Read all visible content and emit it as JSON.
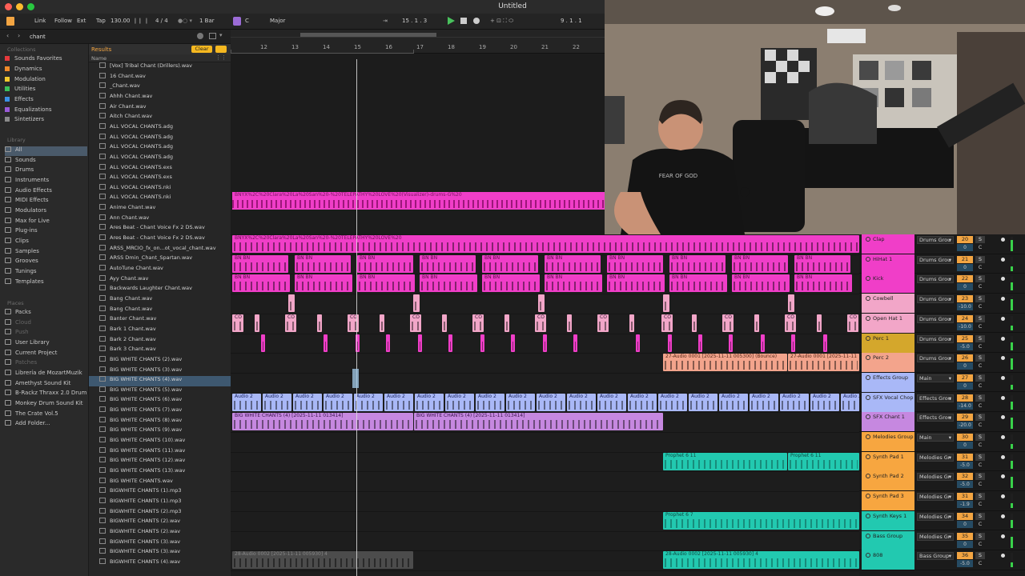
{
  "window": {
    "title": "Untitled"
  },
  "control_bar": {
    "link": "Link",
    "follow": "Follow",
    "ext": "Ext",
    "tap": "Tap",
    "tempo": "130.00",
    "signature": "4 / 4",
    "quantize": "1 Bar",
    "key": "C",
    "scale": "Major",
    "position": "15 .  1 .  3",
    "loop_end": "9 .  1 .  1"
  },
  "browser": {
    "search_value": "chant",
    "collections_label": "Collections",
    "collections": [
      {
        "label": "Sounds Favorites",
        "color": "#e5393c"
      },
      {
        "label": "Dynamics",
        "color": "#f08a2a"
      },
      {
        "label": "Modulation",
        "color": "#f2c82e"
      },
      {
        "label": "Utilities",
        "color": "#3ac05a"
      },
      {
        "label": "Effects",
        "color": "#3a90e5"
      },
      {
        "label": "Equalizations",
        "color": "#9a5ad8"
      },
      {
        "label": "Sintetizers",
        "color": "#8a8a8a"
      }
    ],
    "library_label": "Library",
    "library": [
      "All",
      "Sounds",
      "Drums",
      "Instruments",
      "Audio Effects",
      "MIDI Effects",
      "Modulators",
      "Max for Live",
      "Plug-ins",
      "Clips",
      "Samples",
      "Grooves",
      "Tunings",
      "Templates"
    ],
    "places_label": "Places",
    "places": [
      "Packs",
      "Cloud",
      "Push",
      "User Library",
      "Current Project",
      "Patches",
      "Librería de MozartMuzik",
      "Amethyst Sound Kit",
      "B-Rackz Thraxx 2.0 Drum",
      "Monkey Drum Sound Kit",
      "The Crate Vol.5",
      "Add Folder..."
    ],
    "results_label": "Results",
    "clear_label": "Clear",
    "name_header": "Name",
    "files": [
      "[Vox] Tribal Chant (Drillers).wav",
      "16 Chant.wav",
      "_Chant.wav",
      "Ahhh Chant.wav",
      "Air Chant.wav",
      "Aitch Chant.wav",
      "ALL VOCAL CHANTS.adg",
      "ALL VOCAL CHANTS.adg",
      "ALL VOCAL CHANTS.adg",
      "ALL VOCAL CHANTS.adg",
      "ALL VOCAL CHANTS.exs",
      "ALL VOCAL CHANTS.exs",
      "ALL VOCAL CHANTS.nki",
      "ALL VOCAL CHANTS.nki",
      "Anime Chant.wav",
      "Ann Chant.wav",
      "Ares Beat - Chant Voice Fx 2 DS.wav",
      "Ares Beat - Chant Voice Fx 2 DS.wav",
      "ARSS_MRCIO_fx_on...ot_vocal_chant.wav",
      "ARSS Dmin_Chant_Spartan.wav",
      "AutoTune Chant.wav",
      "Ayy Chant.wav",
      "Backwards Laughter Chant.wav",
      "Bang Chant.wav",
      "Bang Chant.wav",
      "Banter Chant.wav",
      "Bark 1 Chant.wav",
      "Bark 2 Chant.wav",
      "Bark 3 Chant.wav",
      "BIG WHITE CHANTS (2).wav",
      "BIG WHITE CHANTS (3).wav",
      "BIG WHITE CHANTS (4).wav",
      "BIG WHITE CHANTS (5).wav",
      "BIG WHITE CHANTS (6).wav",
      "BIG WHITE CHANTS (7).wav",
      "BIG WHITE CHANTS (8).wav",
      "BIG WHITE CHANTS (9).wav",
      "BIG WHITE CHANTS (10).wav",
      "BIG WHITE CHANTS (11).wav",
      "BIG WHITE CHANTS (12).wav",
      "BIG WHITE CHANTS (13).wav",
      "BIG WHITE CHANTS.wav",
      "BIGWHITE CHANTS (1).mp3",
      "BIGWHITE CHANTS (1).mp3",
      "BIGWHITE CHANTS (2).mp3",
      "BIGWHITE CHANTS (2).wav",
      "BIGWHITE CHANTS (2).wav",
      "BIGWHITE CHANTS (3).wav",
      "BIGWHITE CHANTS (3).wav",
      "BIGWHITE CHANTS (4).wav"
    ],
    "selected_file": "BIG WHITE CHANTS (4).wav"
  },
  "ruler": {
    "bars": [
      "12",
      "13",
      "14",
      "15",
      "16",
      "17",
      "18",
      "19",
      "20",
      "21",
      "22"
    ]
  },
  "clips": {
    "top_drum": "BNYX%2C%20Clara%20La%20San%20-%20TELEPATHY%20LOVE%20(Visualizer)-drums-G%20",
    "drum_row": "BNYX%2C%20Clara%20La%20San%20-%20TELEPATHY%20LOVE%20",
    "short_bn": "BN BN",
    "cowbell_short": "CO",
    "bounce1": "27-Audio 0001 [2025-11-11 005300] (Bounce)",
    "bounce2": "27-Audio 0001 [2025-11-11",
    "audio2": "Audio 2",
    "big_white1": "BIG WHITE CHANTS (4) [2025-11-11 013414]",
    "big_white2": "BIG WHITE CHANTS (4) [2025-11-11 013414]",
    "prophet1": "Prophet 6 11",
    "prophet2": "Prophet 6 11",
    "prophet3": "Prophet 6 7",
    "audio0002a": "28-Audio 0002 [2025-11-11 005930] 4",
    "audio0002b": "28-Audio 0002 [2025-11-11 005930] 4"
  },
  "tracks": [
    {
      "name": "Clap",
      "color": "#f03ec8",
      "io": "Drums Grou",
      "num": "20",
      "vol": "0"
    },
    {
      "name": "HiHat 1",
      "color": "#f03ec8",
      "io": "Drums Grou",
      "num": "21",
      "vol": "0"
    },
    {
      "name": "Kick",
      "color": "#f03ec8",
      "io": "Drums Grou",
      "num": "22",
      "vol": "0"
    },
    {
      "name": "Cowbell",
      "color": "#f2a6c8",
      "io": "Drums Grou",
      "num": "23",
      "vol": "-10.0"
    },
    {
      "name": "Open Hat 1",
      "color": "#f2a6c8",
      "io": "Drums Grou",
      "num": "24",
      "vol": "-10.0"
    },
    {
      "name": "Perc 1",
      "color": "#d4a72c",
      "io": "Drums Grou",
      "num": "25",
      "vol": "-5.0"
    },
    {
      "name": "Perc 2",
      "color": "#f3a48c",
      "io": "Drums Grou",
      "num": "26",
      "vol": "0"
    },
    {
      "name": "Effects Group",
      "color": "#a9b8f7",
      "io": "Main",
      "num": "27",
      "vol": "0"
    },
    {
      "name": "SFX Vocal Chop",
      "color": "#a9b8f7",
      "io": "Effects Grou",
      "num": "28",
      "vol": "-14.0"
    },
    {
      "name": "SFX Chant 1",
      "color": "#c688e0",
      "io": "Effects Grou",
      "num": "29",
      "vol": "-20.0"
    },
    {
      "name": "Melodies Group",
      "color": "#f7a640",
      "io": "Main",
      "num": "30",
      "vol": "0"
    },
    {
      "name": "Synth Pad 1",
      "color": "#f7a640",
      "io": "Melodies Gr",
      "num": "31",
      "vol": "-5.0"
    },
    {
      "name": "Synth Pad 2",
      "color": "#f7a640",
      "io": "Melodies Gr",
      "num": "32",
      "vol": "-5.0"
    },
    {
      "name": "Synth Pad 3",
      "color": "#f7a640",
      "io": "Melodies Gr",
      "num": "31",
      "vol": "-1.9"
    },
    {
      "name": "Synth Keys 1",
      "color": "#22c9b0",
      "io": "Melodies Gr",
      "num": "34",
      "vol": "0"
    },
    {
      "name": "Bass Group",
      "color": "#22c9b0",
      "io": "Melodies Gr",
      "num": "35",
      "vol": "0"
    },
    {
      "name": "808",
      "color": "#22c9b0",
      "io": "Bass Group",
      "num": "36",
      "vol": "-5.0"
    }
  ]
}
